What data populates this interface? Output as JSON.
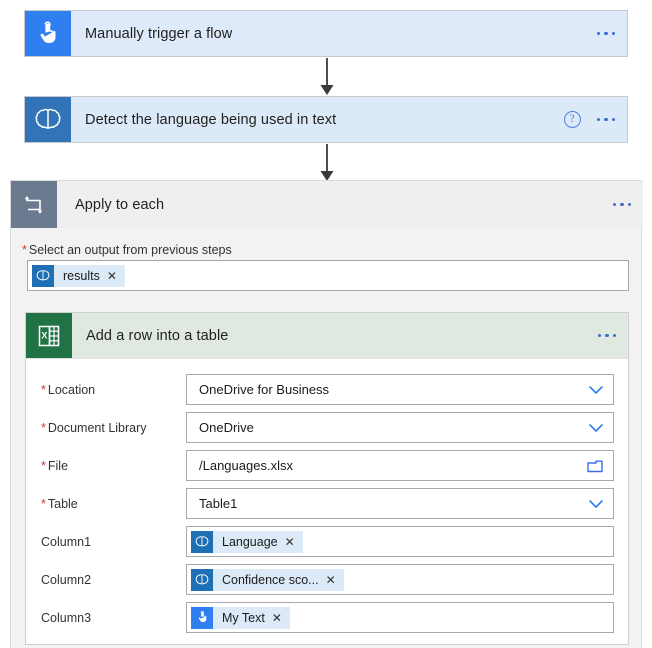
{
  "flow": {
    "trigger": {
      "title": "Manually trigger a flow",
      "icon": "touch-trigger-icon",
      "icon_bg": "#2f7ff0",
      "card_bg": "#deeafa",
      "menu": "..."
    },
    "detect": {
      "title": "Detect the language being used in text",
      "icon": "cognitive-brain-icon",
      "icon_bg": "#3374b8",
      "card_bg": "#dce9f8",
      "help": "?",
      "menu": "..."
    },
    "loop": {
      "title": "Apply to each",
      "icon": "loop-repeat-icon",
      "icon_bg": "#6b7a8f",
      "header_bg": "#efefef",
      "menu": "...",
      "select_output": {
        "label": "Select an output from previous steps",
        "required_marker": "*",
        "token": {
          "text": "results",
          "remove": "✕",
          "icon": "cognitive-brain-icon"
        }
      }
    },
    "excel_action": {
      "title": "Add a row into a table",
      "icon": "excel-icon",
      "icon_bg": "#217346",
      "header_bg": "#dfe9e0",
      "menu": "...",
      "fields": [
        {
          "label": "Location",
          "required": true,
          "required_marker": "*",
          "value": "OneDrive for Business",
          "control": "dropdown",
          "affix_icon": "chevron-down-icon"
        },
        {
          "label": "Document Library",
          "required": true,
          "required_marker": "*",
          "value": "OneDrive",
          "control": "dropdown",
          "affix_icon": "chevron-down-icon"
        },
        {
          "label": "File",
          "required": true,
          "required_marker": "*",
          "value": "/Languages.xlsx",
          "control": "file-picker",
          "affix_icon": "folder-icon"
        },
        {
          "label": "Table",
          "required": true,
          "required_marker": "*",
          "value": "Table1",
          "control": "dropdown",
          "affix_icon": "chevron-down-icon"
        },
        {
          "label": "Column1",
          "required": false,
          "required_marker": "",
          "control": "token",
          "token": {
            "text": "Language",
            "remove": "✕",
            "icon": "cognitive-brain-icon",
            "icon_bg": "#1f6fb5"
          }
        },
        {
          "label": "Column2",
          "required": false,
          "required_marker": "",
          "control": "token",
          "token": {
            "text": "Confidence sco...",
            "remove": "✕",
            "icon": "cognitive-brain-icon",
            "icon_bg": "#1f6fb5"
          }
        },
        {
          "label": "Column3",
          "required": false,
          "required_marker": "",
          "control": "token",
          "token": {
            "text": "My Text",
            "remove": "✕",
            "icon": "touch-trigger-icon",
            "icon_bg": "#2f7ff0"
          }
        }
      ]
    }
  },
  "theme": {
    "accent": "#2f7ff0",
    "required_red": "#d13438",
    "excel_green": "#217346",
    "arrow": "#3b3a39"
  }
}
